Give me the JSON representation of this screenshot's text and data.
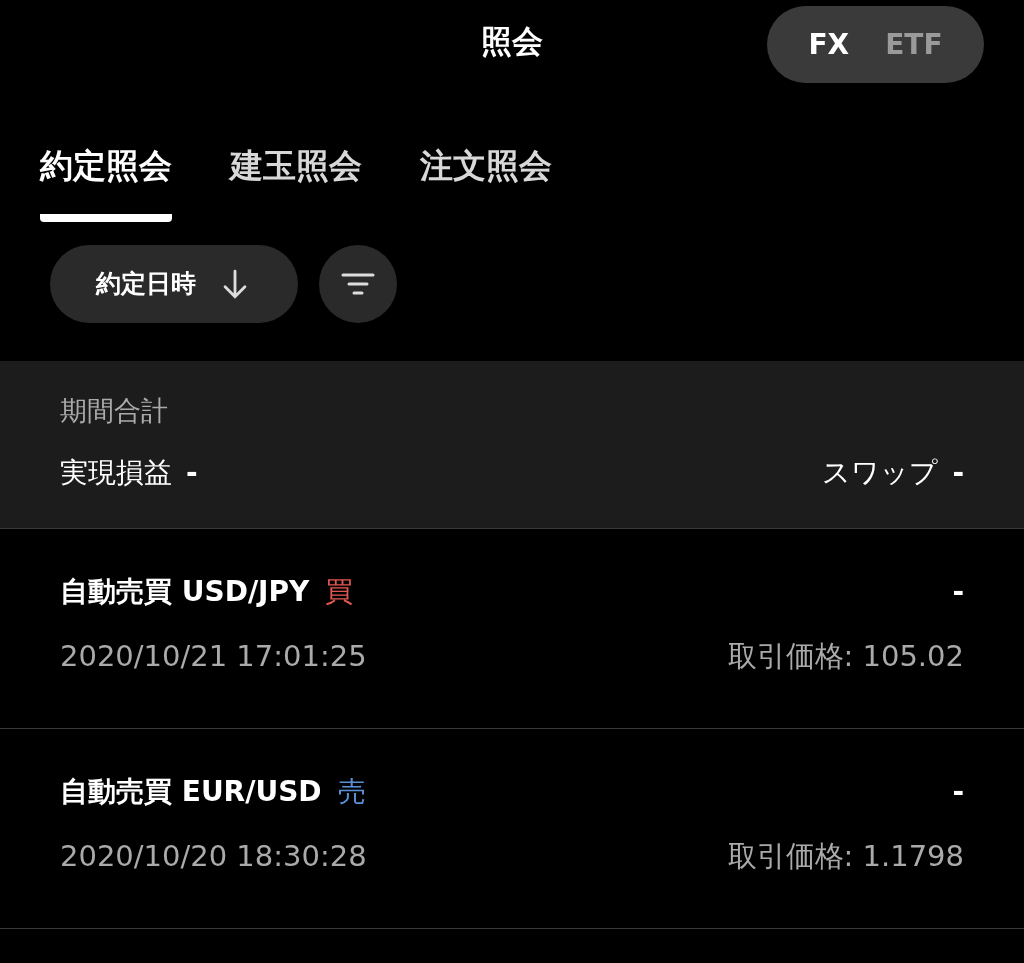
{
  "header": {
    "title": "照会"
  },
  "market_toggle": [
    {
      "label": "FX",
      "selected": true
    },
    {
      "label": "ETF",
      "selected": false
    }
  ],
  "tabs": [
    {
      "label": "約定照会",
      "selected": true
    },
    {
      "label": "建玉照会",
      "selected": false
    },
    {
      "label": "注文照会",
      "selected": false
    }
  ],
  "sort_button": {
    "label": "約定日時"
  },
  "summary": {
    "title": "期間合計",
    "realized_label": "実現損益",
    "realized_value": "-",
    "swap_label": "スワップ",
    "swap_value": "-"
  },
  "trades": [
    {
      "title": "自動売買 USD/JPY",
      "side": "買",
      "color": "#e0584f",
      "profit": "-",
      "datetime": "2020/10/21 17:01:25",
      "price": "取引価格: 105.02"
    },
    {
      "title": "自動売買 EUR/USD",
      "side": "売",
      "color": "#5b8fd6",
      "profit": "-",
      "datetime": "2020/10/20 18:30:28",
      "price": "取引価格: 1.1798"
    }
  ]
}
